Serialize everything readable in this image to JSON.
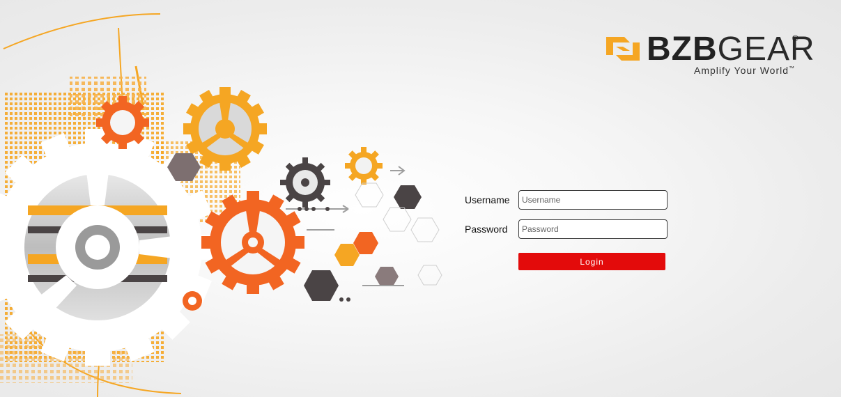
{
  "brand": {
    "name_bold": "BZB",
    "name_light": "GEAR",
    "registered": "®",
    "tagline": "Amplify Your World",
    "trademark": "™",
    "logo_icon": "bzbgear-chain-icon",
    "accent_color": "#f5a623"
  },
  "form": {
    "username_label": "Username",
    "username_placeholder": "Username",
    "username_value": "",
    "password_label": "Password",
    "password_placeholder": "Password",
    "password_value": "",
    "login_label": "Login",
    "login_color": "#e30b0b"
  },
  "background": {
    "illustration": "gears-tech-illustration",
    "colors": [
      "#f5a623",
      "#f26522",
      "#4a4445",
      "#ffffff"
    ]
  }
}
